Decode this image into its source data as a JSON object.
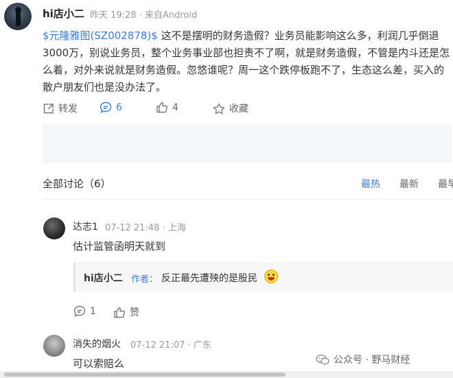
{
  "post": {
    "author": "hi店小二",
    "meta": "昨天 19:28 · 来自Android",
    "stock_tag": "$元隆雅图(SZ002878)$",
    "body": " 这不是摆明的财务造假？业务员能影响这么多，利润几乎倒退3000万，别说业务员，整个业务事业部也担责不了啊，就是财务造假，不管是内斗还是怎么着，对外来说就是财务造假。忽悠谁呢？周一这个跌停板跑不了，生态这么差，买入的散户朋友们也是没办法了。",
    "actions": {
      "share_label": "转发",
      "comment_count": "6",
      "like_count": "4",
      "favorite_label": "收藏"
    }
  },
  "discussion": {
    "title": "全部讨论（6）",
    "sort_tabs": [
      "最热",
      "最新",
      "最早"
    ],
    "active_tab": "最热"
  },
  "comments": [
    {
      "name": "达志1",
      "meta": "07-12 21:48 · 上海",
      "text": "估计监管函明天就到",
      "reply": {
        "author": "hi店小二",
        "tag": "作者：",
        "text": "反正最先遭殃的是股民"
      },
      "comment_count": "1",
      "like_label": "赞"
    },
    {
      "name": "消失的烟火",
      "meta": "07-12 21:07 · 广东",
      "text": "可以索赔么"
    }
  ],
  "watermark": {
    "text": "公众号 · 野马财经"
  },
  "colors": {
    "accent": "#3a7ce0",
    "muted": "#9a9a9a"
  }
}
